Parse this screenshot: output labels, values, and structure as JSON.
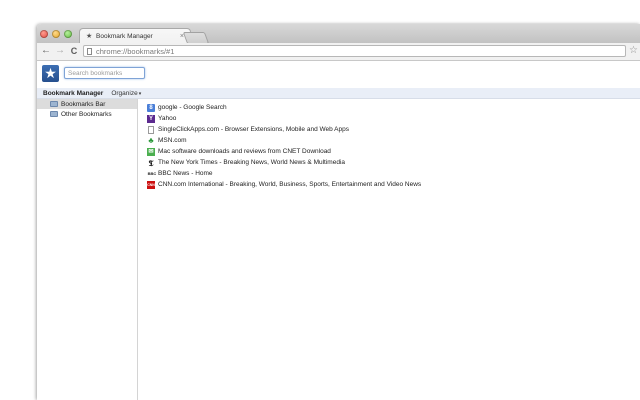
{
  "tab": {
    "title": "Bookmark Manager",
    "close": "×"
  },
  "toolbar": {
    "url": "chrome://bookmarks/#1"
  },
  "manager": {
    "search_placeholder": "Search bookmarks",
    "title": "Bookmark Manager",
    "organize_label": "Organize",
    "organize_caret": "▾"
  },
  "tree": [
    {
      "label": "Bookmarks Bar",
      "selected": true
    },
    {
      "label": "Other Bookmarks",
      "selected": false
    }
  ],
  "bookmarks": [
    {
      "title": "google - Google Search",
      "icon": "google-icon",
      "color": "#4a7fd8",
      "glyph": "8"
    },
    {
      "title": "Yahoo",
      "icon": "yahoo-icon",
      "color": "#5c2a8f",
      "glyph": "Y"
    },
    {
      "title": "SingleClickApps.com - Browser Extensions, Mobile and Web Apps",
      "icon": "page-icon",
      "color": "#ffffff",
      "glyph": ""
    },
    {
      "title": "MSN.com",
      "icon": "msn-icon",
      "color": "#2d9a3c",
      "glyph": "♣"
    },
    {
      "title": "Mac software downloads and reviews from CNET Download",
      "icon": "cnet-icon",
      "color": "#4caf50",
      "glyph": "✉"
    },
    {
      "title": "The New York Times - Breaking News, World News & Multimedia",
      "icon": "nyt-icon",
      "color": "#ffffff",
      "glyph": "𝕿"
    },
    {
      "title": "BBC News - Home",
      "icon": "bbc-icon",
      "color": "#222222",
      "glyph": "BBC"
    },
    {
      "title": "CNN.com International - Breaking, World, Business, Sports, Entertainment and Video News",
      "icon": "cnn-icon",
      "color": "#cc1111",
      "glyph": "CNN"
    }
  ]
}
